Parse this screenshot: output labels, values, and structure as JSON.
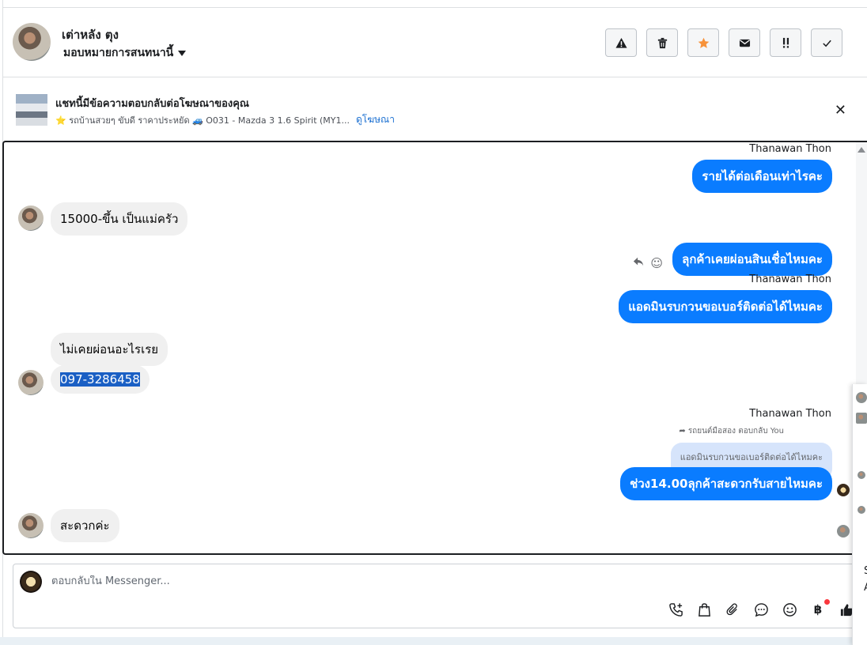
{
  "header": {
    "contact_name": "เต่าหลัง ตุง",
    "assign_label": "มอบหมายการสนทนานี้",
    "actions": [
      "spam-icon",
      "trash-icon",
      "star-icon",
      "mail-icon",
      "follow-up-icon",
      "done-icon"
    ]
  },
  "ad": {
    "title": "แชทนี้มีข้อความตอบกลับต่อโฆษณาของคุณ",
    "subtitle": "⭐ รถบ้านสวยๆ ขับดี ราคาประหยัด 🚙 O031 - Mazda 3 1.6 Spirit (MY1...",
    "link": "ดูโฆษณา"
  },
  "messages": {
    "m1_sender": "Thanawan Thon",
    "m1_text": "รายได้ต่อเดือนเท่าไรคะ",
    "m2_text": "15000-ขึ้น เป็นแม่ครัว",
    "m3_text": "ลุกค้าเคยผ่อนสินเชื่อไหมคะ",
    "m4_sender": "Thanawan Thon",
    "m4_text": "แอดมินรบกวนขอเบอร์ติดต่อได้ไหมคะ",
    "m5_text": "ไม่เคยผ่อนอะไรเรย",
    "m6_text": "097-3286458",
    "m7_sender": "Thanawan Thon",
    "m7_reply_note": "รถยนต์มือสอง ตอบกลับ You",
    "m7_quoted": "แอดมินรบกวนขอเบอร์ติดต่อได้ไหมคะ",
    "m7_text": "ช่วง14.00ลุกค้าสะดวกรับสายไหมคะ",
    "m8_text": "สะดวกค่ะ"
  },
  "composer": {
    "placeholder": "ตอบกลับใน Messenger...",
    "tools": [
      "call-add-icon",
      "shopping-bag-icon",
      "attachment-icon",
      "chat-bubble-icon",
      "emoji-icon",
      "payment-icon",
      "like-icon"
    ],
    "payment_symbol": "฿"
  },
  "side_panel": {
    "text_1": "S",
    "text_2": "A"
  },
  "colors": {
    "outgoing_bubble": "#0a7cff",
    "incoming_bubble": "#f0f0f0",
    "link": "#1a6fd1",
    "star": "#f7923a",
    "selection": "#1a5fc4"
  }
}
